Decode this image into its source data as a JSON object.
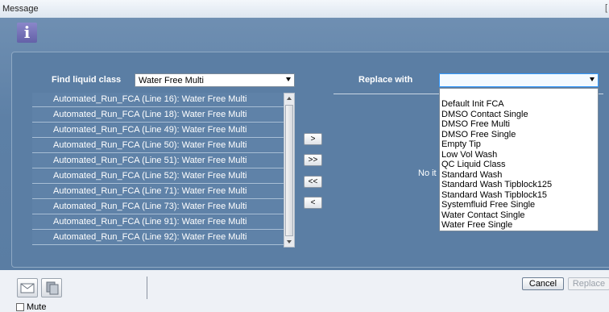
{
  "window": {
    "title": "Message",
    "close_glyph": "["
  },
  "find": {
    "label": "Find liquid class",
    "selected": "Water Free Multi",
    "results": [
      "Automated_Run_FCA (Line 16): Water Free Multi",
      "Automated_Run_FCA (Line 18): Water Free Multi",
      "Automated_Run_FCA (Line 49): Water Free Multi",
      "Automated_Run_FCA (Line 50): Water Free Multi",
      "Automated_Run_FCA (Line 51): Water Free Multi",
      "Automated_Run_FCA (Line 52): Water Free Multi",
      "Automated_Run_FCA (Line 71): Water Free Multi",
      "Automated_Run_FCA (Line 73): Water Free Multi",
      "Automated_Run_FCA (Line 91): Water Free Multi",
      "Automated_Run_FCA (Line 92): Water Free Multi"
    ]
  },
  "move_buttons": {
    "move_right": ">",
    "move_all_right": ">>",
    "move_all_left": "<<",
    "move_left": "<"
  },
  "replace": {
    "label": "Replace with",
    "selected": "",
    "no_items_text": "No it",
    "options": [
      "Default Init FCA",
      "DMSO Contact Single",
      "DMSO Free Multi",
      "DMSO Free Single",
      "Empty Tip",
      "Low Vol Wash",
      "QC Liquid Class",
      "Standard Wash",
      "Standard Wash Tipblock125",
      "Standard Wash Tipblock15",
      "Systemfluid Free Single",
      "Water Contact Single",
      "Water Free Single"
    ]
  },
  "footer": {
    "cancel_label": "Cancel",
    "replace_label": "Replace",
    "mute_label": "Mute"
  },
  "icons": {
    "info": "i",
    "envelope": "envelope-icon",
    "copy": "copy-icon"
  },
  "colors": {
    "panel": "#5a7da3",
    "info_icon": "#6461a8",
    "dropdown_focus": "#3399ff"
  }
}
